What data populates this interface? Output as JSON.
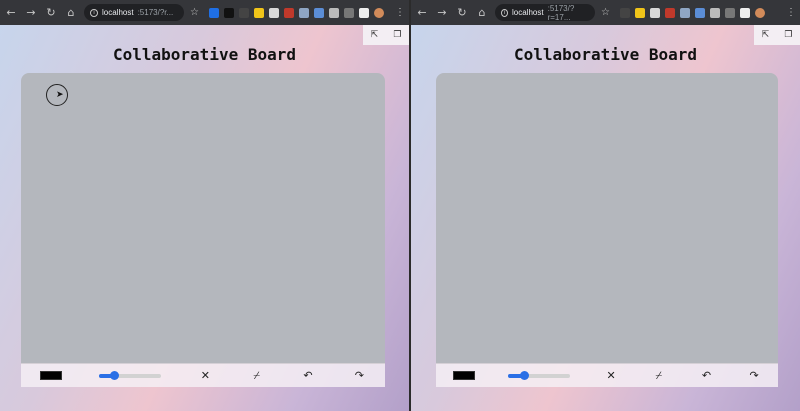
{
  "browser": {
    "url_host": "localhost",
    "left_url_path": ":5173/?r...",
    "right_url_path": ":5173/?r=17..."
  },
  "app": {
    "title": "Collaborative Board"
  },
  "toolbar": {
    "stroke_color": "#000000",
    "brush_size_fraction": 0.25,
    "clear_glyph": "✕",
    "eraser_glyph": "⌿",
    "undo_glyph": "↶",
    "redo_glyph": "↷"
  },
  "corner": {
    "open_glyph": "⇱",
    "copy_glyph": "❐"
  },
  "chrome": {
    "back_glyph": "←",
    "forward_glyph": "→",
    "reload_glyph": "↻",
    "home_glyph": "⌂",
    "star_glyph": "☆",
    "menu_glyph": "⋮"
  },
  "colors": {
    "accent": "#2a6fe6",
    "board": "#b4b7bd"
  }
}
